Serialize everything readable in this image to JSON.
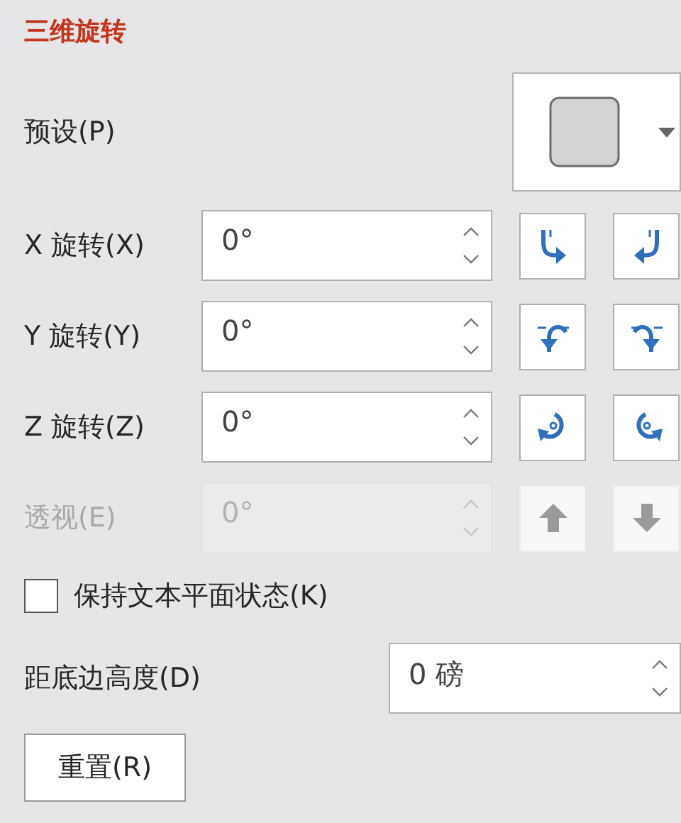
{
  "section": {
    "title": "三维旋转"
  },
  "preset": {
    "label": "预设(P)"
  },
  "rotation_rows": [
    {
      "label": "X 旋转(X)",
      "value": "0°",
      "disabled": false
    },
    {
      "label": "Y 旋转(Y)",
      "value": "0°",
      "disabled": false
    },
    {
      "label": "Z 旋转(Z)",
      "value": "0°",
      "disabled": false
    },
    {
      "label": "透视(E)",
      "value": "0°",
      "disabled": true
    }
  ],
  "keep_text_flat": {
    "label": "保持文本平面状态(K)",
    "checked": false
  },
  "distance": {
    "label": "距底边高度(D)",
    "value": "0 磅"
  },
  "reset_button": {
    "label": "重置(R)"
  }
}
